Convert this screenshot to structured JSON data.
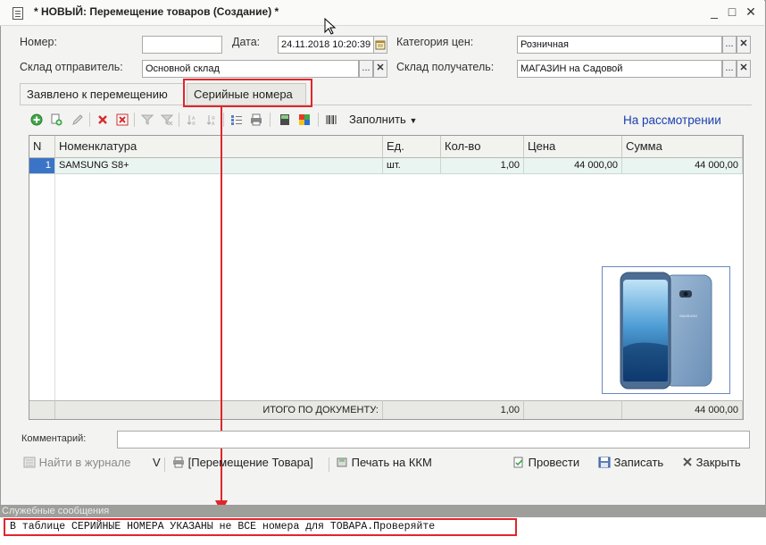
{
  "window": {
    "title": "* НОВЫЙ: Перемещение товаров (Создание) *",
    "minimize": "_",
    "maximize": "□",
    "close": "✕"
  },
  "form": {
    "number_label": "Номер:",
    "number_value": "",
    "date_label": "Дата:",
    "date_value": "24.11.2018 10:20:39",
    "price_category_label": "Категория цен:",
    "price_category_value": "Розничная",
    "sender_label": "Склад отправитель:",
    "sender_value": "Основной склад",
    "receiver_label": "Склад получатель:",
    "receiver_value": "МАГАЗИН на Садовой",
    "select_btn": "...",
    "clear_btn": "✕"
  },
  "tabs": [
    {
      "label": "Заявлено к перемещению"
    },
    {
      "label": "Серийные номера"
    }
  ],
  "toolbar": {
    "fill_label": "Заполнить",
    "status": "На рассмотрении"
  },
  "table": {
    "columns": [
      "N",
      "Номенклатура",
      "Ед.",
      "Кол-во",
      "Цена",
      "Сумма"
    ],
    "rows": [
      {
        "n": "1",
        "name": "SAMSUNG S8+",
        "unit": "шт.",
        "qty": "1,00",
        "price": "44 000,00",
        "sum": "44 000,00"
      }
    ],
    "footer_label": "ИТОГО ПО ДОКУМЕНТУ:",
    "footer_qty": "1,00",
    "footer_sum": "44 000,00"
  },
  "comment": {
    "label": "Комментарий:",
    "value": ""
  },
  "bottom": {
    "find_journal": "Найти в журнале",
    "v_label": "V",
    "print_move": "[Перемещение Товара]",
    "print_kkm": "Печать на ККМ",
    "post": "Провести",
    "save": "Записать",
    "close": "Закрыть"
  },
  "messages": {
    "title": "Служебные сообщения",
    "items": [
      "В таблице СЕРИЙНЫЕ НОМЕРА УКАЗАНЫ не ВСЕ номера для ТОВАРА.Проверяйте"
    ]
  },
  "colors": {
    "accent_red": "#e0262c",
    "status_blue": "#1a3fb0",
    "row_selected": "#3b74c6"
  }
}
